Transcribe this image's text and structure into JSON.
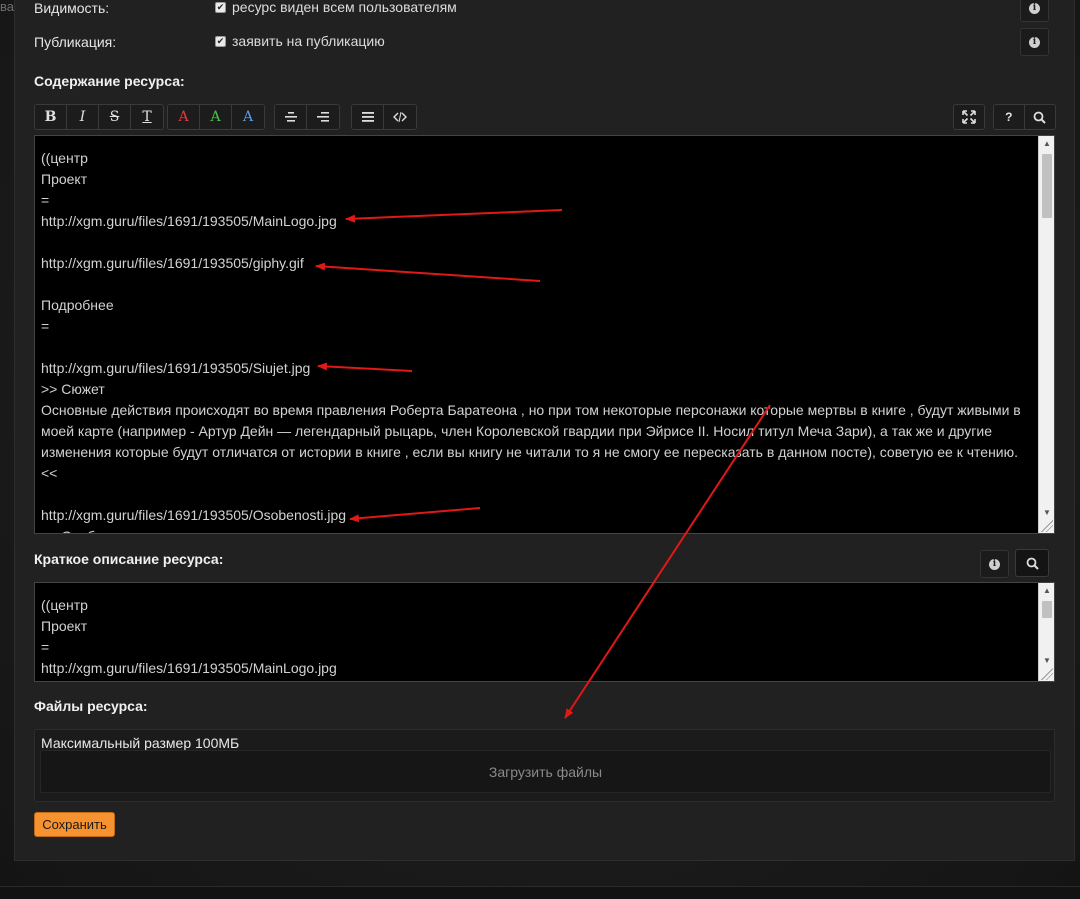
{
  "corner_text": "вани",
  "visibility": {
    "label": "Видимость:",
    "checkbox_label": "ресурс виден всем пользователям",
    "checked": true
  },
  "publication": {
    "label": "Публикация:",
    "checkbox_label": "заявить на публикацию",
    "checked": true
  },
  "content_section": {
    "title": "Содержание ресурса:",
    "toolbar": {
      "format": [
        {
          "name": "bold",
          "glyph": "B"
        },
        {
          "name": "italic",
          "glyph": "I"
        },
        {
          "name": "strike",
          "glyph": "S"
        },
        {
          "name": "clear-format",
          "glyph": "T"
        }
      ],
      "colors": [
        {
          "name": "red",
          "glyph": "A",
          "color": "#e03a3a"
        },
        {
          "name": "green",
          "glyph": "A",
          "color": "#49c24a"
        },
        {
          "name": "blue",
          "glyph": "A",
          "color": "#5b9ae6"
        }
      ]
    },
    "text": "((центр\nПроект\n=\nhttp://xgm.guru/files/1691/193505/MainLogo.jpg\n\nhttp://xgm.guru/files/1691/193505/giphy.gif\n\nПодробнее\n=\n\nhttp://xgm.guru/files/1691/193505/Siujet.jpg\n>> Сюжет\nОсновные действия происходят во время правления Роберта Баратеона , но при том некоторые персонажи которые мертвы в книге , будут живыми в моей карте (например - Артур Дейн — легендарный рыцарь, член Королевской гвардии при Эйрисе II. Носил титул Меча Зари), а так же и другие изменения которые будут отличатся от истории в книге , если вы книгу не читали то я не смогу ее пересказать в данном посте), советую ее к чтению.\n<<\n\nhttp://xgm.guru/files/1691/193505/Osobenosti.jpg\n>> Особенности"
  },
  "short_description": {
    "title": "Краткое описание ресурса:",
    "text": "((центр\nПроект\n=\nhttp://xgm.guru/files/1691/193505/MainLogo.jpg"
  },
  "files_section": {
    "title": "Файлы ресурса:",
    "max_size": "Максимальный размер 100МБ",
    "upload_label": "Загрузить файлы"
  },
  "save_label": "Сохранить",
  "colors": {
    "accent": "#f6922f",
    "annotation_arrow": "#e01818"
  }
}
